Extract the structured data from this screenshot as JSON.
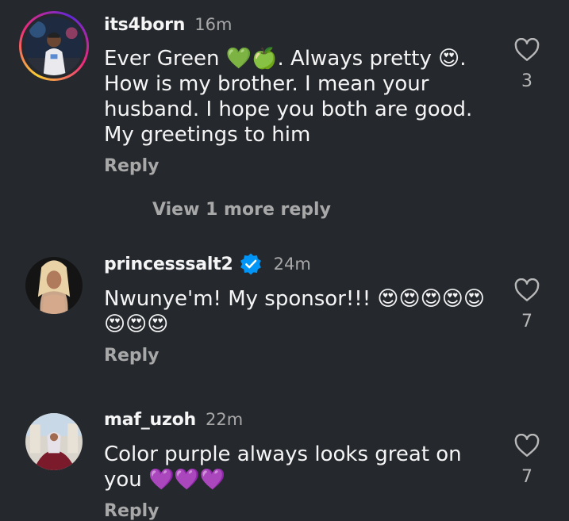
{
  "comments": [
    {
      "username": "its4born",
      "time": "16m",
      "text": "Ever Green 💚🍏. Always pretty 😍. How is my brother. I mean your husband. I hope you both are good. My greetings to him",
      "reply_label": "Reply",
      "like_count": "3",
      "view_more": "View 1 more reply",
      "verified": false
    },
    {
      "username": "princesssalt2",
      "time": "24m",
      "text": "Nwunye'm! My sponsor!!! 😍😍😍😍😍😍😍😍",
      "reply_label": "Reply",
      "like_count": "7",
      "verified": true
    },
    {
      "username": "maf_uzoh",
      "time": "22m",
      "text": "Color purple always looks great on you 💜💜💜",
      "reply_label": "Reply",
      "like_count": "7",
      "verified": false
    }
  ],
  "colors": {
    "background": "#25292e",
    "text_primary": "#f5f5f5",
    "text_secondary": "#a8a8a8",
    "verified_blue": "#0095f6"
  },
  "icons": {
    "like": "heart-outline-icon",
    "verified": "verified-badge-icon"
  }
}
